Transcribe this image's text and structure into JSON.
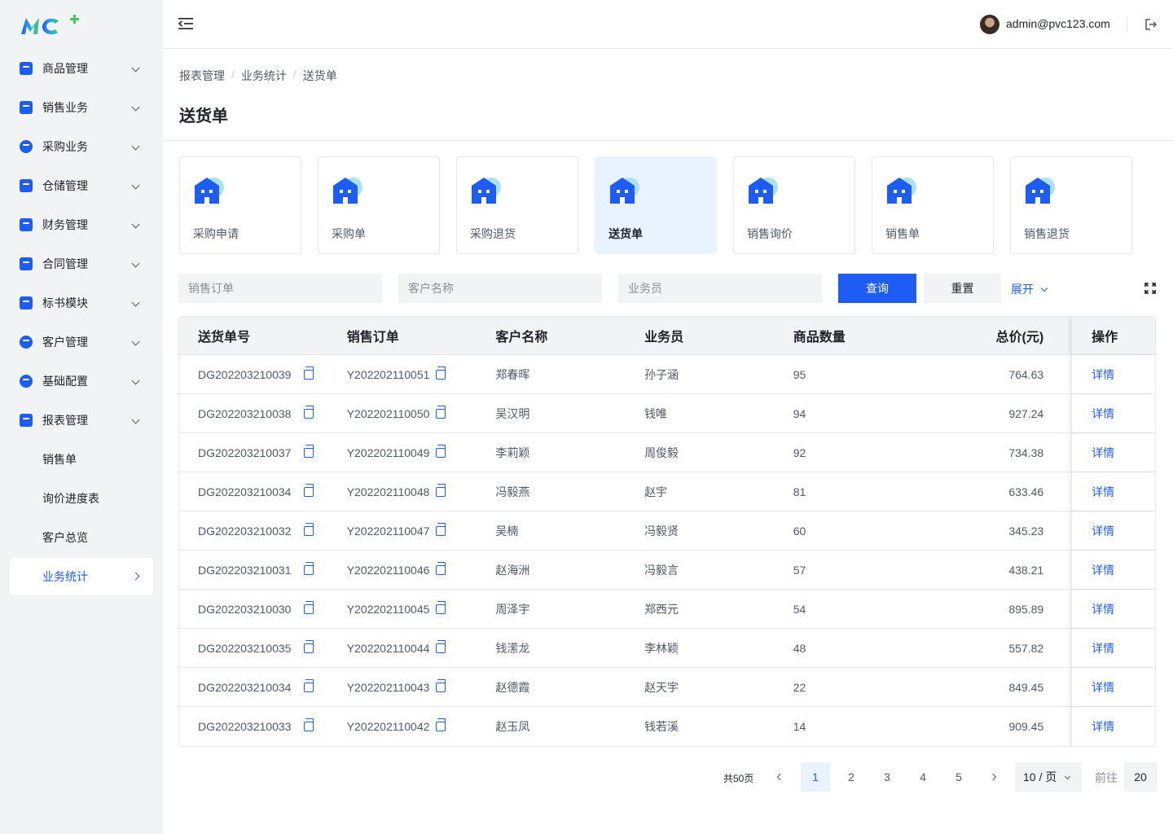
{
  "sidebar": {
    "items": [
      {
        "label": "商品管理",
        "icon": "bag-icon"
      },
      {
        "label": "销售业务",
        "icon": "briefcase-icon"
      },
      {
        "label": "采购业务",
        "icon": "robot-icon"
      },
      {
        "label": "仓储管理",
        "icon": "box-icon"
      },
      {
        "label": "财务管理",
        "icon": "wallet-icon"
      },
      {
        "label": "合同管理",
        "icon": "contract-icon"
      },
      {
        "label": "标书模块",
        "icon": "document-icon"
      },
      {
        "label": "客户管理",
        "icon": "user-icon"
      },
      {
        "label": "基础配置",
        "icon": "gear-icon"
      },
      {
        "label": "报表管理",
        "icon": "clipboard-icon"
      }
    ],
    "subitems": [
      "销售单",
      "询价进度表",
      "客户总览",
      "业务统计"
    ]
  },
  "header": {
    "email": "admin@pvc123.com"
  },
  "breadcrumb": [
    "报表管理",
    "业务统计",
    "送货单"
  ],
  "breadcrumb_sep": "/",
  "page_title": "送货单",
  "cards": [
    "采购申请",
    "采购单",
    "采购退货",
    "送货单",
    "销售询价",
    "销售单",
    "销售退货"
  ],
  "filters": {
    "order_placeholder": "销售订单",
    "customer_placeholder": "客户名称",
    "salesman_placeholder": "业务员",
    "query": "查询",
    "reset": "重置",
    "expand": "展开"
  },
  "table": {
    "headers": [
      "送货单号",
      "销售订单",
      "客户名称",
      "业务员",
      "商品数量",
      "总价(元)",
      "操作"
    ],
    "rows": [
      {
        "no": "DG202203210039",
        "order": "Y202202110051",
        "customer": "郑春晖",
        "salesman": "孙子涵",
        "qty": "95",
        "total": "764.63",
        "action": "详情"
      },
      {
        "no": "DG202203210038",
        "order": "Y202202110050",
        "customer": "吴汉明",
        "salesman": "钱唯",
        "qty": "94",
        "total": "927.24",
        "action": "详情"
      },
      {
        "no": "DG202203210037",
        "order": "Y202202110049",
        "customer": "李莉颖",
        "salesman": "周俊毅",
        "qty": "92",
        "total": "734.38",
        "action": "详情"
      },
      {
        "no": "DG202203210034",
        "order": "Y202202110048",
        "customer": "冯毅燕",
        "salesman": "赵宇",
        "qty": "81",
        "total": "633.46",
        "action": "详情"
      },
      {
        "no": "DG202203210032",
        "order": "Y202202110047",
        "customer": "吴楠",
        "salesman": "冯毅贤",
        "qty": "60",
        "total": "345.23",
        "action": "详情"
      },
      {
        "no": "DG202203210031",
        "order": "Y202202110046",
        "customer": "赵海洲",
        "salesman": "冯毅言",
        "qty": "57",
        "total": "438.21",
        "action": "详情"
      },
      {
        "no": "DG202203210030",
        "order": "Y202202110045",
        "customer": "周泽宇",
        "salesman": "郑西元",
        "qty": "54",
        "total": "895.89",
        "action": "详情"
      },
      {
        "no": "DG202203210035",
        "order": "Y202202110044",
        "customer": "钱潆龙",
        "salesman": "李林颖",
        "qty": "48",
        "total": "557.82",
        "action": "详情"
      },
      {
        "no": "DG202203210034",
        "order": "Y202202110043",
        "customer": "赵德霞",
        "salesman": "赵天宇",
        "qty": "22",
        "total": "849.45",
        "action": "详情"
      },
      {
        "no": "DG202203210033",
        "order": "Y202202110042",
        "customer": "赵玉凤",
        "salesman": "钱若溪",
        "qty": "14",
        "total": "909.45",
        "action": "详情"
      }
    ]
  },
  "pagination": {
    "total": "共50页",
    "pages": [
      "1",
      "2",
      "3",
      "4",
      "5"
    ],
    "current": "1",
    "page_size": "10 / 页",
    "goto_label": "前往",
    "goto_value": "20"
  },
  "colors": {
    "accent": "#1d5cf5",
    "sidebar_bg": "#f2f3f5",
    "active_card_bg": "#e8f3ff"
  }
}
